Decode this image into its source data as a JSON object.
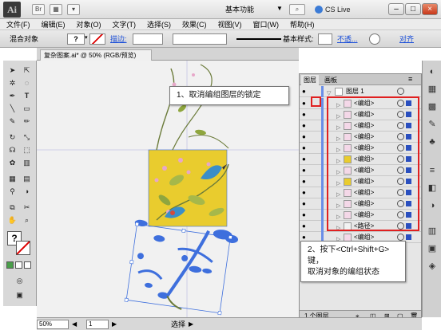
{
  "app": {
    "logo": "Ai",
    "workspace": "基本功能",
    "live": "CS Live"
  },
  "window_controls": {
    "minimize": "–",
    "maximize": "□",
    "close": "×"
  },
  "menus": [
    "文件(F)",
    "编辑(E)",
    "对象(O)",
    "文字(T)",
    "选择(S)",
    "效果(C)",
    "视图(V)",
    "窗口(W)",
    "帮助(H)"
  ],
  "control_bar": {
    "selection_label": "混合对象",
    "stroke_label": "描边:",
    "stroke_style": "基本",
    "style_label": "样式:",
    "opacity_link": "不透...",
    "align_link": "对齐"
  },
  "document": {
    "tab_title": "复杂图案.ai* @ 50% (RGB/预览)"
  },
  "layers_panel": {
    "tabs": [
      "图层",
      "画板"
    ],
    "top_layer": "图层 1",
    "rows": [
      "<编组>",
      "<编组>",
      "<编组>",
      "<编组>",
      "<编组>",
      "<编组>",
      "<编组>",
      "<编组>",
      "<编组>",
      "<编组>",
      "<编组>",
      "<路径>",
      "<编组>"
    ],
    "footer": "1 个图层"
  },
  "status": {
    "zoom": "50%",
    "artboard": "1",
    "mode": "选择"
  },
  "callouts": {
    "step1": "1、取消编组图层的锁定",
    "step2_line1": "2、按下<Ctrl+Shift+G>键，",
    "step2_line2": "取消对象的编组状态"
  },
  "icons": [
    "selection-tool-icon",
    "direct-selection-tool-icon",
    "magic-wand-icon",
    "lasso-icon",
    "pen-tool-icon",
    "type-tool-icon",
    "line-tool-icon",
    "rectangle-tool-icon",
    "paintbrush-icon",
    "pencil-icon",
    "rotate-icon",
    "scale-icon",
    "warp-icon",
    "free-transform-icon",
    "symbol-sprayer-icon",
    "graph-icon",
    "mesh-icon",
    "gradient-icon",
    "eyedropper-icon",
    "blend-icon",
    "artboard-icon",
    "slice-icon",
    "hand-icon",
    "zoom-icon",
    "fill-stroke-icon",
    "eye-icon",
    "lock-icon",
    "target-icon"
  ],
  "colors": {
    "highlight": "#e02020",
    "selection": "#2a4fbf",
    "artwork_yellow": "#e9cc2e",
    "artwork_blue": "#3e6fdd"
  }
}
